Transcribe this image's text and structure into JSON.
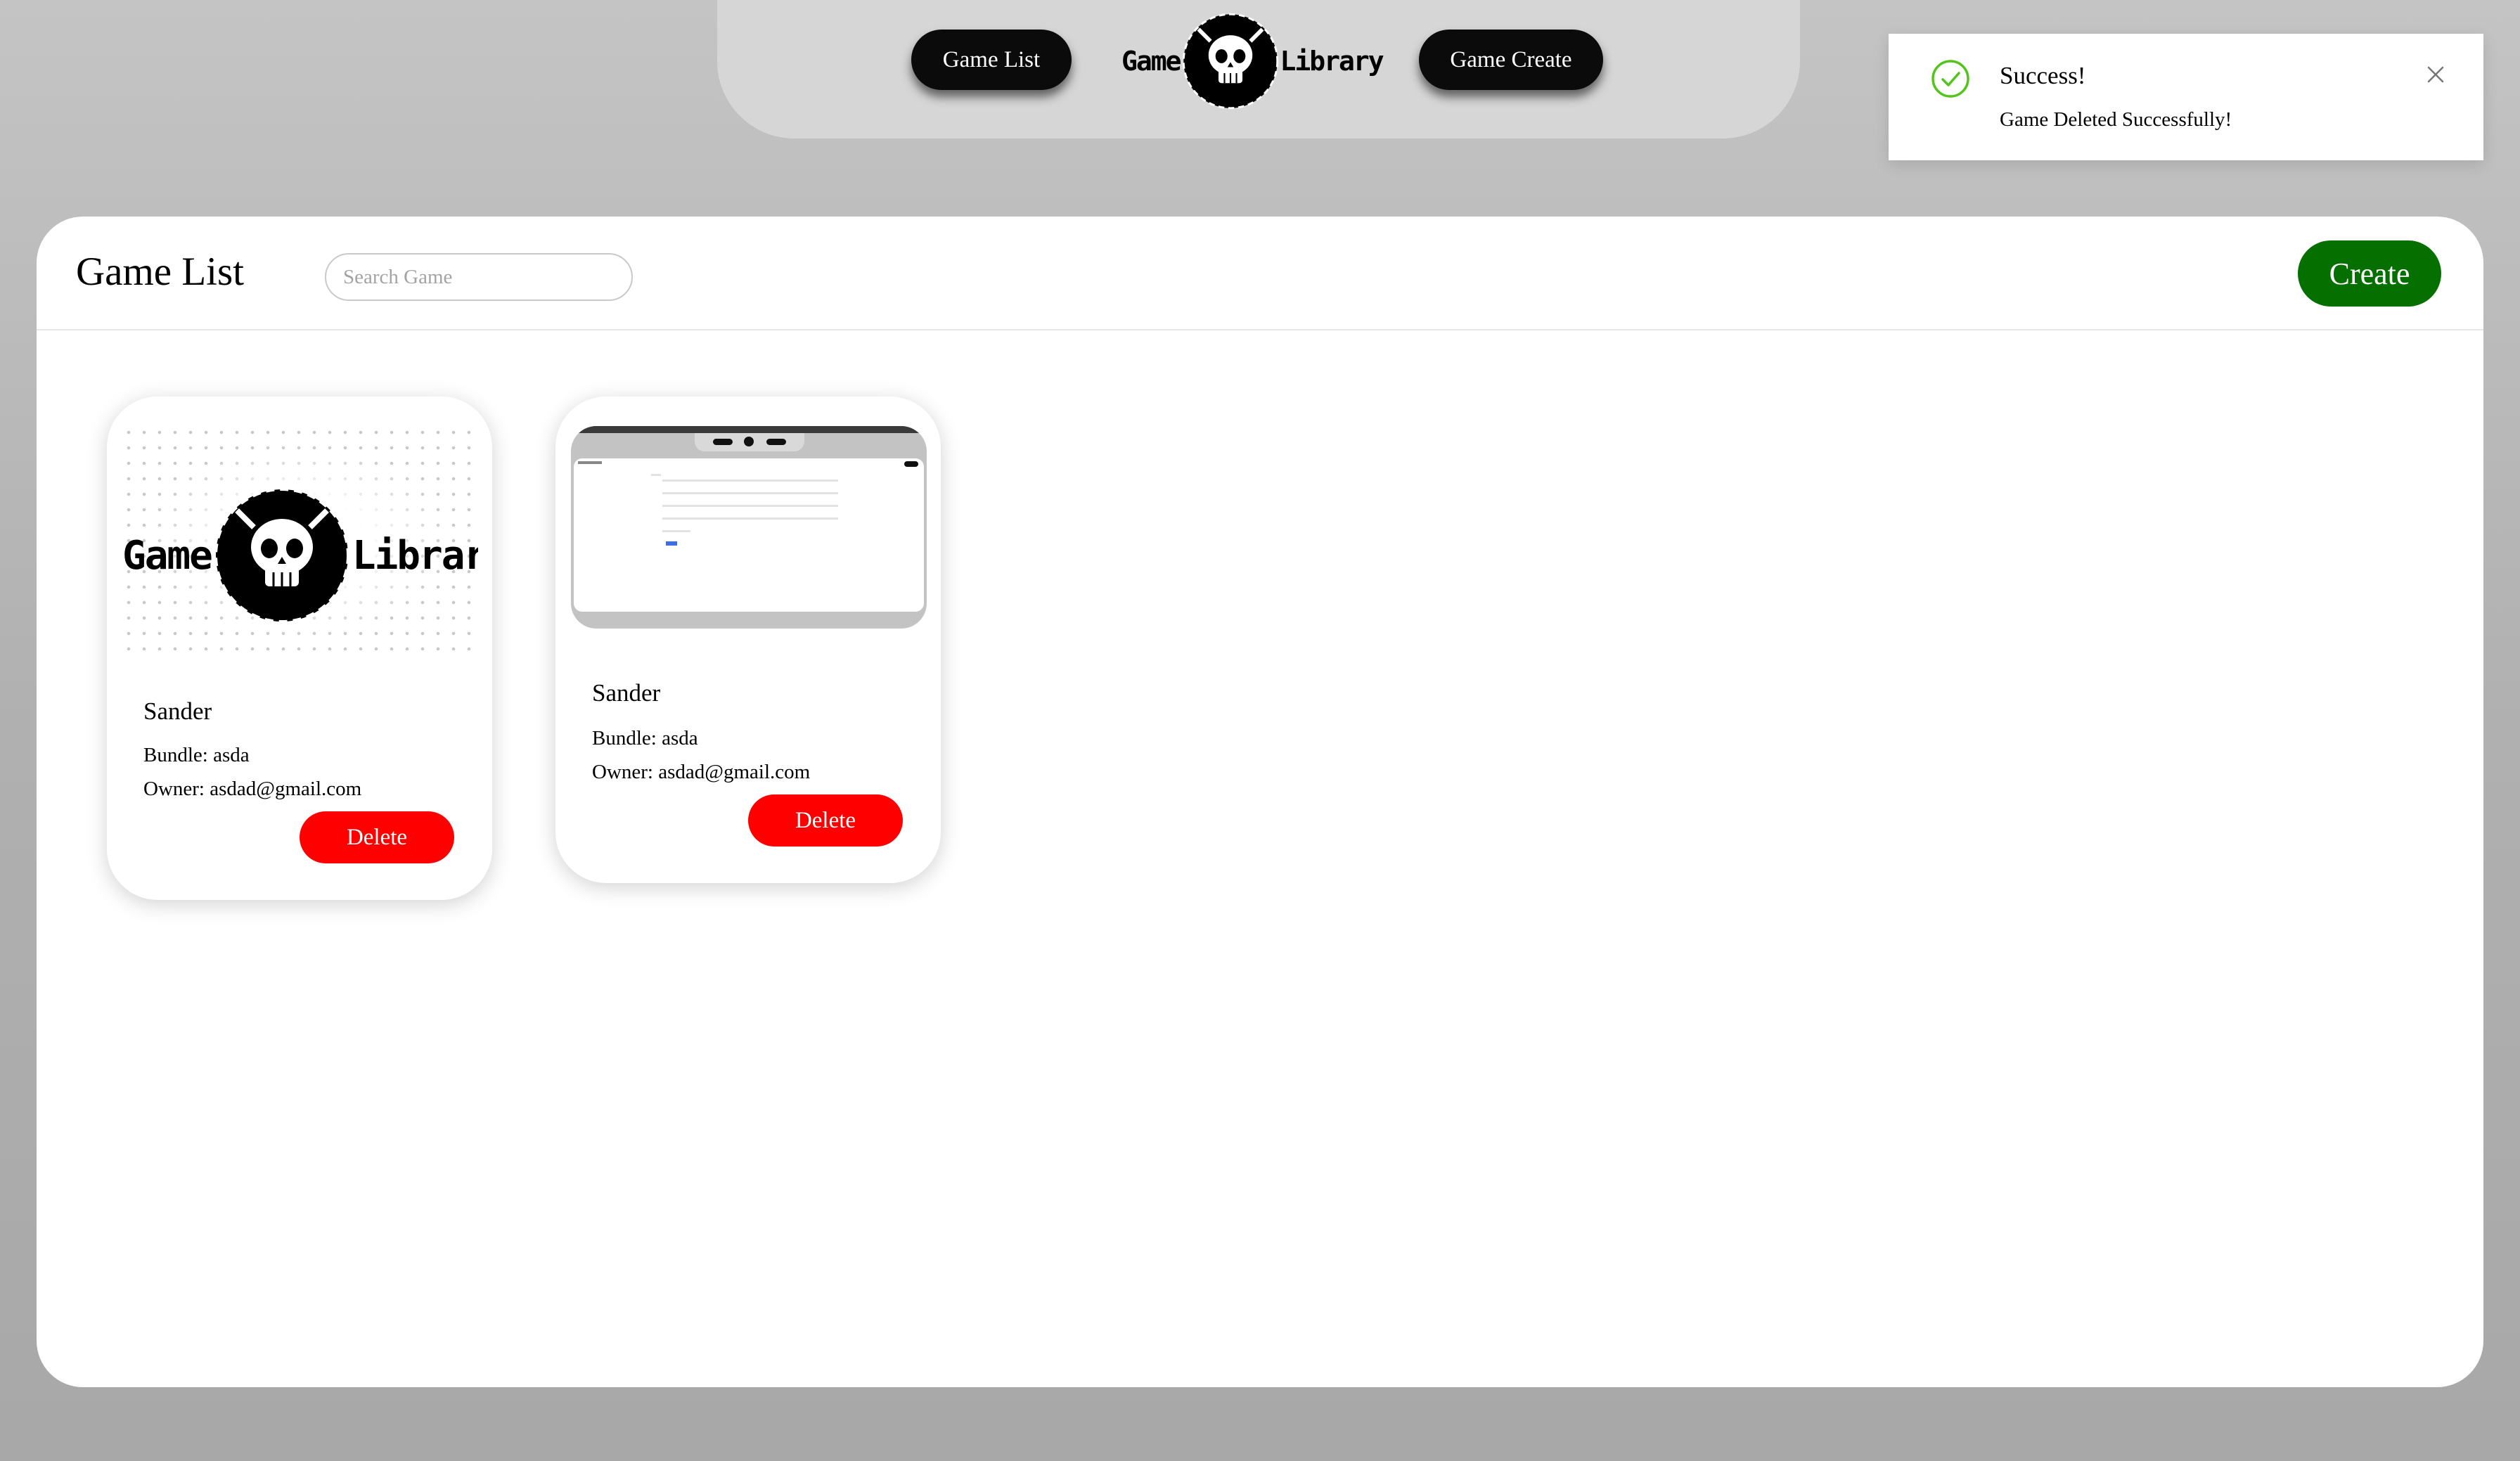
{
  "nav": {
    "game_list_label": "Game List",
    "game_create_label": "Game Create",
    "logo": {
      "left_word": "Game",
      "right_word": "Library"
    }
  },
  "toast": {
    "title": "Success!",
    "message": "Game Deleted Successfully!",
    "icon": "check-circle-icon",
    "close_icon": "close-icon",
    "accent": "#52c41a"
  },
  "page": {
    "title": "Game List",
    "search_placeholder": "Search Game",
    "search_value": "",
    "create_label": "Create",
    "create_color": "#057000"
  },
  "games": [
    {
      "name": "Sander",
      "bundle": "Bundle: asda",
      "owner": "Owner: asdad@gmail.com",
      "delete_label": "Delete",
      "image": "game-library-logo"
    },
    {
      "name": "Sander",
      "bundle": "Bundle: asda",
      "owner": "Owner: asdad@gmail.com",
      "delete_label": "Delete",
      "image": "screenshot-thumbnail"
    }
  ],
  "colors": {
    "delete": "#ff0000",
    "nav_button": "#0b0b0b"
  }
}
